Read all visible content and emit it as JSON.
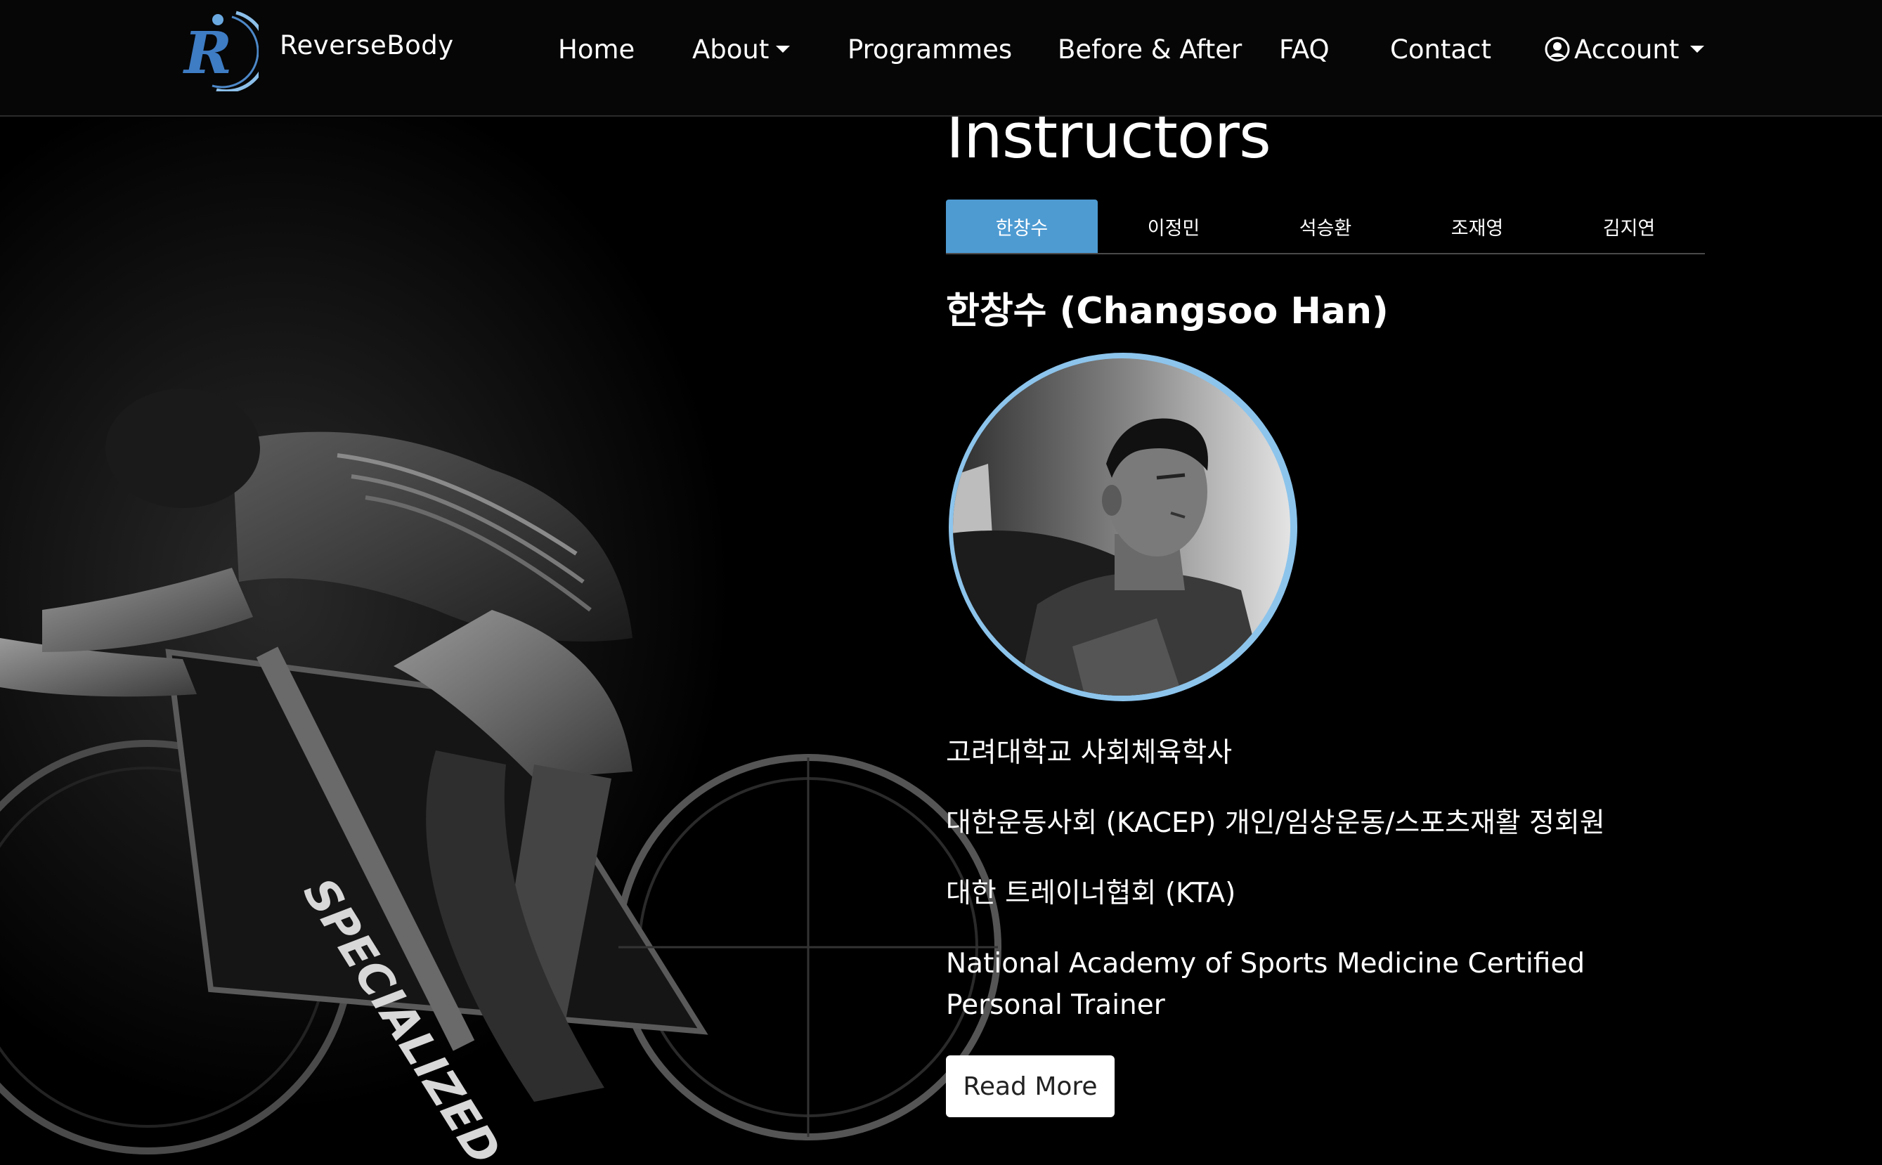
{
  "navbar": {
    "brand": "ReverseBody",
    "items": [
      {
        "label": "Home"
      },
      {
        "label": "About"
      },
      {
        "label": "Programmes"
      },
      {
        "label": "Before & After"
      },
      {
        "label": "FAQ"
      },
      {
        "label": "Contact"
      },
      {
        "label": "Account"
      }
    ]
  },
  "instructors": {
    "title": "Instructors",
    "tabs": [
      {
        "label": "한창수",
        "active": true
      },
      {
        "label": "이정민",
        "active": false
      },
      {
        "label": "석승환",
        "active": false
      },
      {
        "label": "조재영",
        "active": false
      },
      {
        "label": "김지연",
        "active": false
      }
    ],
    "selected": {
      "name": "한창수 (Changsoo Han)",
      "credentials": [
        "고려대학교 사회체육학사",
        "대한운동사회 (KACEP) 개인/임상운동/스포츠재활 정회원",
        "대한 트레이너협회 (KTA)",
        "National Academy of Sports Medicine Certified Personal Trainer"
      ],
      "read_more": "Read More"
    }
  },
  "hero": {
    "bike_brand": "SPECIALIZED"
  },
  "colors": {
    "accent": "#4e9bd2",
    "portrait_ring": "#8cc4ec",
    "background": "#000000"
  }
}
